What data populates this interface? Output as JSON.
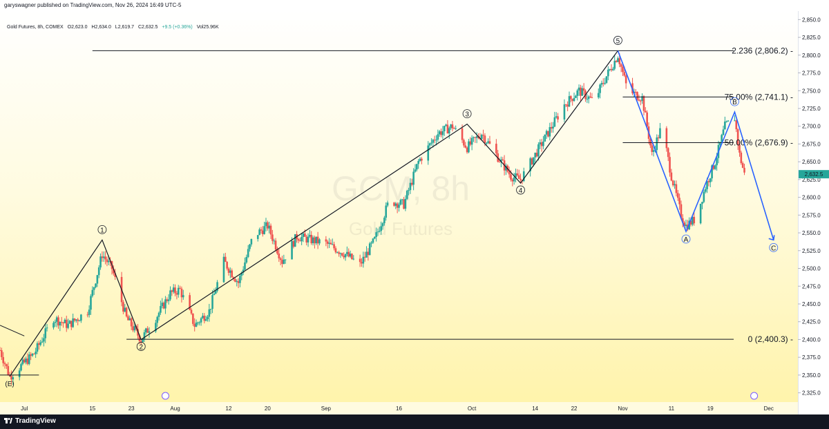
{
  "publisher_line": "garyswagner published on TradingView.com, Nov 26, 2024 16:49 UTC-5",
  "brand": "TradingView",
  "legend": {
    "symbol": "Gold Futures, 8h, COMEX",
    "open": "O2,623.0",
    "high": "H2,634.0",
    "low": "L2,619.7",
    "close": "C2,632.5",
    "change": "+9.5 (+0.36%)",
    "volume": "Vol25.96K"
  },
  "watermark": {
    "ticker": "GCM, 8h",
    "name": "Gold Futures"
  },
  "colors": {
    "up": "#26a69a",
    "down": "#ef5350",
    "wave": "#131722",
    "abc": "#2962ff",
    "last_price": "#26a69a"
  },
  "chart_data": {
    "type": "candlestick",
    "ylim": [
      2312,
      2862
    ],
    "y_ticks": [
      2325,
      2350,
      2375,
      2400,
      2425,
      2450,
      2475,
      2500,
      2525,
      2550,
      2575,
      2600,
      2625,
      2650,
      2675,
      2700,
      2725,
      2750,
      2775,
      2800,
      2825,
      2850
    ],
    "y_tick_labels": [
      "2,325.0",
      "2,350.0",
      "2,375.0",
      "2,400.0",
      "2,425.0",
      "2,450.0",
      "2,475.0",
      "2,500.0",
      "2,525.0",
      "2,550.0",
      "2,575.0",
      "2,600.0",
      "2,625.0",
      "2,650.0",
      "2,675.0",
      "2,700.0",
      "2,725.0",
      "2,750.0",
      "2,775.0",
      "2,800.0",
      "2,825.0",
      "2,850.0"
    ],
    "x_range": [
      "2024-06-26",
      "2024-12-07"
    ],
    "x_ticks": [
      {
        "date": "2024-07-01",
        "label": "Jul"
      },
      {
        "date": "2024-07-15",
        "label": "15"
      },
      {
        "date": "2024-07-23",
        "label": "23"
      },
      {
        "date": "2024-08-01",
        "label": "Aug"
      },
      {
        "date": "2024-08-12",
        "label": "12"
      },
      {
        "date": "2024-08-20",
        "label": "20"
      },
      {
        "date": "2024-09-01",
        "label": "Sep"
      },
      {
        "date": "2024-09-16",
        "label": "16"
      },
      {
        "date": "2024-10-01",
        "label": "Oct"
      },
      {
        "date": "2024-10-14",
        "label": "14"
      },
      {
        "date": "2024-10-22",
        "label": "22"
      },
      {
        "date": "2024-11-01",
        "label": "Nov"
      },
      {
        "date": "2024-11-11",
        "label": "11"
      },
      {
        "date": "2024-11-19",
        "label": "19"
      },
      {
        "date": "2024-12-01",
        "label": "Dec"
      }
    ],
    "price_path": [
      [
        "2024-06-26",
        2385
      ],
      [
        "2024-06-28",
        2348
      ],
      [
        "2024-07-03",
        2380
      ],
      [
        "2024-07-07",
        2430
      ],
      [
        "2024-07-10",
        2420
      ],
      [
        "2024-07-14",
        2440
      ],
      [
        "2024-07-17",
        2520
      ],
      [
        "2024-07-19",
        2500
      ],
      [
        "2024-07-22",
        2430
      ],
      [
        "2024-07-25",
        2400
      ],
      [
        "2024-07-28",
        2430
      ],
      [
        "2024-07-31",
        2465
      ],
      [
        "2024-08-02",
        2470
      ],
      [
        "2024-08-05",
        2420
      ],
      [
        "2024-08-08",
        2440
      ],
      [
        "2024-08-11",
        2510
      ],
      [
        "2024-08-14",
        2480
      ],
      [
        "2024-08-17",
        2545
      ],
      [
        "2024-08-20",
        2560
      ],
      [
        "2024-08-23",
        2510
      ],
      [
        "2024-08-26",
        2545
      ],
      [
        "2024-08-29",
        2540
      ],
      [
        "2024-09-01",
        2535
      ],
      [
        "2024-09-05",
        2520
      ],
      [
        "2024-09-08",
        2505
      ],
      [
        "2024-09-11",
        2540
      ],
      [
        "2024-09-14",
        2595
      ],
      [
        "2024-09-17",
        2590
      ],
      [
        "2024-09-20",
        2650
      ],
      [
        "2024-09-24",
        2690
      ],
      [
        "2024-09-27",
        2700
      ],
      [
        "2024-09-30",
        2670
      ],
      [
        "2024-10-03",
        2690
      ],
      [
        "2024-10-06",
        2660
      ],
      [
        "2024-10-09",
        2630
      ],
      [
        "2024-10-11",
        2625
      ],
      [
        "2024-10-14",
        2660
      ],
      [
        "2024-10-17",
        2695
      ],
      [
        "2024-10-20",
        2730
      ],
      [
        "2024-10-23",
        2750
      ],
      [
        "2024-10-26",
        2735
      ],
      [
        "2024-10-29",
        2775
      ],
      [
        "2024-10-31",
        2800
      ],
      [
        "2024-11-02",
        2750
      ],
      [
        "2024-11-05",
        2740
      ],
      [
        "2024-11-07",
        2660
      ],
      [
        "2024-11-09",
        2700
      ],
      [
        "2024-11-11",
        2630
      ],
      [
        "2024-11-13",
        2575
      ],
      [
        "2024-11-14",
        2560
      ],
      [
        "2024-11-16",
        2570
      ],
      [
        "2024-11-18",
        2615
      ],
      [
        "2024-11-20",
        2650
      ],
      [
        "2024-11-22",
        2700
      ],
      [
        "2024-11-24",
        2712
      ],
      [
        "2024-11-25",
        2660
      ],
      [
        "2024-11-26",
        2632.5
      ]
    ],
    "elliott_waves": [
      {
        "label": "(E)",
        "date": "2024-06-28",
        "price": 2348
      },
      {
        "label": "1",
        "date": "2024-07-17",
        "price": 2540
      },
      {
        "label": "2",
        "date": "2024-07-25",
        "price": 2400
      },
      {
        "label": "3",
        "date": "2024-09-30",
        "price": 2703
      },
      {
        "label": "4",
        "date": "2024-10-11",
        "price": 2620
      },
      {
        "label": "5",
        "date": "2024-10-31",
        "price": 2806.2
      }
    ],
    "correction_abc": [
      {
        "label": "A",
        "date": "2024-11-14",
        "price": 2552
      },
      {
        "label": "B",
        "date": "2024-11-24",
        "price": 2720
      },
      {
        "label": "C",
        "date": "2024-12-02",
        "price": 2540
      }
    ],
    "fib_levels": [
      {
        "label": "2.236 (2,806.2)",
        "price": 2806.2
      },
      {
        "label": "75.00% (2,741.1)",
        "price": 2741.1
      },
      {
        "label": "50.00% (2,676.9)",
        "price": 2676.9
      },
      {
        "label": "0 (2,400.3)",
        "price": 2400.3
      }
    ],
    "last_price": 2632.5,
    "last_price_label": "2,632.5"
  }
}
